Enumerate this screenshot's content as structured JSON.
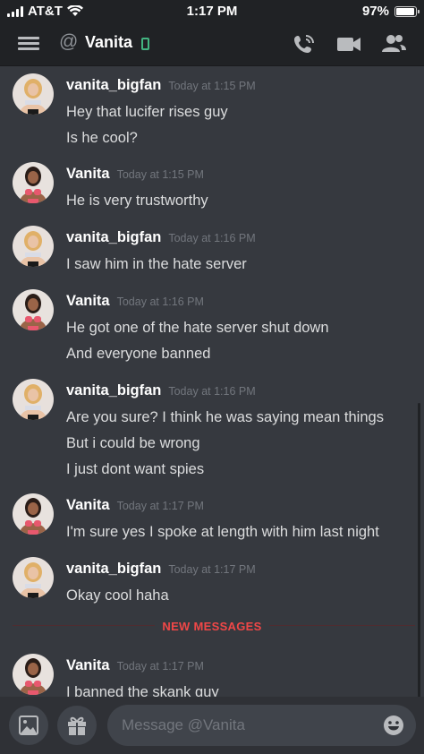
{
  "status_bar": {
    "carrier": "AT&T",
    "time": "1:17 PM",
    "battery": "97%",
    "battery_level": 0.97
  },
  "header": {
    "at_symbol": "@",
    "channel_name": "Vanita",
    "icons": [
      "hamburger-menu-icon",
      "phone-icon",
      "video-camera-icon",
      "members-icon"
    ]
  },
  "messages": [
    {
      "author": "vanita_bigfan",
      "timestamp": "Today at 1:15 PM",
      "lines": [
        "Hey that lucifer rises guy",
        "Is he cool?"
      ]
    },
    {
      "author": "Vanita",
      "timestamp": "Today at 1:15 PM",
      "lines": [
        "He is very trustworthy"
      ]
    },
    {
      "author": "vanita_bigfan",
      "timestamp": "Today at 1:16 PM",
      "lines": [
        "I saw him in the hate server"
      ]
    },
    {
      "author": "Vanita",
      "timestamp": "Today at 1:16 PM",
      "lines": [
        "He got one of the hate server shut down",
        "And everyone banned"
      ]
    },
    {
      "author": "vanita_bigfan",
      "timestamp": "Today at 1:16 PM",
      "lines": [
        "Are you sure? I think he was saying mean things",
        "But i could be wrong",
        "I just dont want spies"
      ]
    },
    {
      "author": "Vanita",
      "timestamp": "Today at 1:17 PM",
      "lines": [
        "I'm sure yes I spoke at length with him last night"
      ]
    },
    {
      "author": "vanita_bigfan",
      "timestamp": "Today at 1:17 PM",
      "lines": [
        "Okay cool haha"
      ]
    },
    {
      "author": "Vanita",
      "timestamp": "Today at 1:17 PM",
      "lines": [
        "I banned the skank guy"
      ]
    }
  ],
  "divider": {
    "label": "NEW MESSAGES"
  },
  "composer": {
    "placeholder": "Message @Vanita",
    "icons": [
      "image-icon",
      "gift-icon",
      "emoji-icon"
    ]
  },
  "colors": {
    "background": "#36393f",
    "header": "#202225",
    "new_messages": "#f04747",
    "online": "#43b581"
  }
}
